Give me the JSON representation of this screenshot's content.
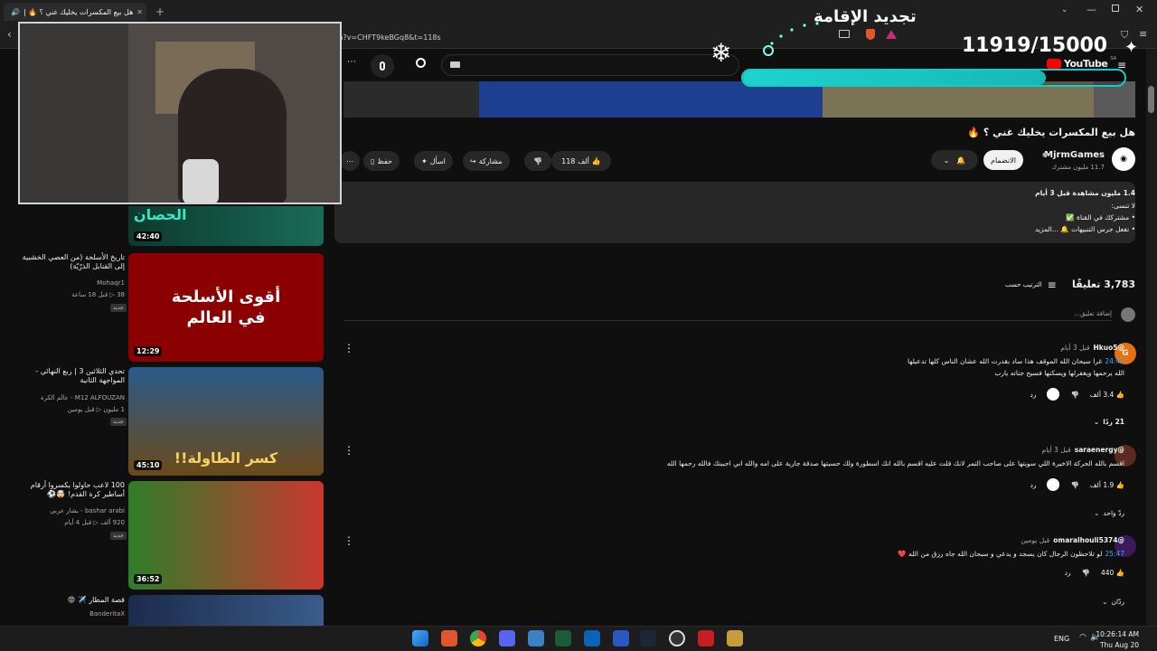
{
  "browser": {
    "tab_title": "هل بيع المكسرات يخليك غني ؟ 🔥 |",
    "url": "ch?v=CHFT9keBGq8&t=118s"
  },
  "youtube": {
    "logo": "YouTube",
    "logo_region": "SA",
    "video_title": "هل بيع المكسرات يخليك غني ؟ 🔥",
    "channel_name": "MjrmGames",
    "subscribers": "11.7 مليون مشترك",
    "join_label": "الانضمام",
    "like_count": "118 ألف",
    "share_label": "مشاركة",
    "ask_label": "اسأل",
    "save_label": "حفظ",
    "description": {
      "stats": "1.4 مليون مشاهدة  قبل 3 أيام",
      "line1": "لا تنسى:",
      "line2": "• مشتركك في القناة ✅",
      "line3": "• تفعل جرس التنبيهات 🔔 ...المزيد"
    },
    "comments_count": "3,783 تعليقًا",
    "sort_label": "الترتيب حسب",
    "add_comment_placeholder": "إضافة تعليق...",
    "comments": [
      {
        "author": "@Hkuo5",
        "time": "قبل 3 أيام",
        "timestamp": "24:42",
        "text": "غرا سبحان الله الموقف هذا ساد بقدرت الله عشان الناس كلها تدعيلها",
        "text2": "الله يرحمها ويغفرلها ويسكنها فسيح جناته يارب",
        "likes": "3.4 ألف",
        "reply": "رد",
        "replies": "21 ردًا",
        "avatar_letter": "G"
      },
      {
        "author": "@saraenergy",
        "time": "قبل 3 أيام",
        "text": "اقسم بالله الحركة الاخيرة اللي سويتها على صاحب التمر لانك قلت عليه اقسم بالله انك اسطورة ولك حسبتها صدقة جارية على امه والله اني احببتك فالله رحمها الله",
        "likes": "1.9 ألف",
        "reply": "رد",
        "replies": "ردّ واحد"
      },
      {
        "author": "@omaralhouli5374",
        "time": "قبل يومين",
        "timestamp": "25:47",
        "text": "لو تلاحظون الرجال كان يسجد و يدعي و سبحان الله جاه رزق من الله ❤️",
        "likes": "440",
        "reply": "رد",
        "replies": "ردّان"
      }
    ],
    "sidebar": [
      {
        "duration": "42:40",
        "title": "",
        "channel": "",
        "meta": ""
      },
      {
        "duration": "12:29",
        "title": "تاريخ الأسلحة (من العصي الخشبية إلى القنابل الذرّيّة)",
        "channel": "Mohaqr1",
        "meta": "38 ▷ قبل 18 ساعة",
        "badge": "جديد",
        "thumb_text": "أقوى الأسلحة في العالم"
      },
      {
        "duration": "45:10",
        "title": "تحدي الثلاثين 3 | ربع النهائي - المواجهة الثانية",
        "channel": "M12 ALFOUZAN - عالم الكرة",
        "meta": "1 مليون ▷ قبل يومين",
        "badge": "جديد",
        "thumb_text": "كسر الطاولة!!"
      },
      {
        "duration": "36:52",
        "title": "100 لاعب حاولوا يكسروا أرقام أساطير كرة القدم! 🤯⚽",
        "channel": "bashar arabi - بشار عربي",
        "meta": "920 ألف ▷ قبل 4 أيام",
        "badge": "جديد"
      },
      {
        "duration": "",
        "title": "قصة المطار ✈️ 😡",
        "channel": "BanderitaX",
        "meta": ""
      }
    ]
  },
  "stream_overlay": {
    "renewal_text": "تجديد الإقامة",
    "progress_text": "11919/15000",
    "progress_fraction": 0.7946,
    "webcam_sign": "الحصان",
    "accent": "#19c9c6"
  },
  "taskbar": {
    "language": "ENG",
    "time": "10:26:14 AM",
    "date": "Thu Aug 20"
  }
}
